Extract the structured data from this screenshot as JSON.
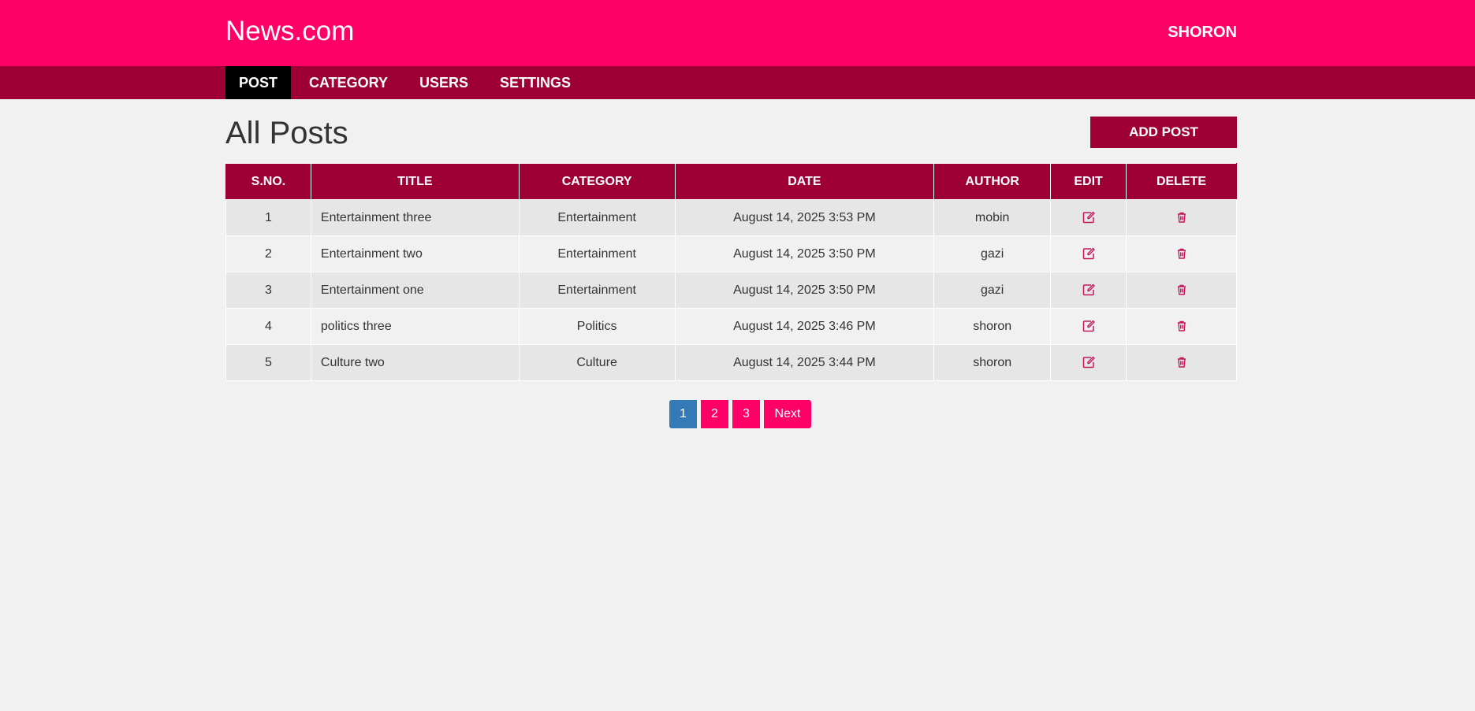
{
  "header": {
    "logo": "News.com",
    "username": "shoron"
  },
  "menu": {
    "items": [
      {
        "label": "POST",
        "active": true
      },
      {
        "label": "CATEGORY"
      },
      {
        "label": "USERS"
      },
      {
        "label": "SETTINGS"
      }
    ]
  },
  "page": {
    "title": "All Posts",
    "add_button": "ADD POST"
  },
  "table": {
    "columns": [
      "S.NO.",
      "TITLE",
      "CATEGORY",
      "DATE",
      "AUTHOR",
      "EDIT",
      "DELETE"
    ],
    "rows": [
      {
        "sno": "1",
        "title": "Entertainment three",
        "category": "Entertainment",
        "date": "August 14, 2025 3:53 PM",
        "author": "mobin"
      },
      {
        "sno": "2",
        "title": "Entertainment two",
        "category": "Entertainment",
        "date": "August 14, 2025 3:50 PM",
        "author": "gazi"
      },
      {
        "sno": "3",
        "title": "Entertainment one",
        "category": "Entertainment",
        "date": "August 14, 2025 3:50 PM",
        "author": "gazi"
      },
      {
        "sno": "4",
        "title": "politics three",
        "category": "Politics",
        "date": "August 14, 2025 3:46 PM",
        "author": "shoron"
      },
      {
        "sno": "5",
        "title": "Culture two",
        "category": "Culture",
        "date": "August 14, 2025 3:44 PM",
        "author": "shoron"
      }
    ],
    "edit_icon": "edit-icon",
    "delete_icon": "trash-icon"
  },
  "pagination": {
    "pages": [
      "1",
      "2",
      "3"
    ],
    "current": "1",
    "next_label": "Next"
  },
  "colors": {
    "brand": "#ff0066",
    "brand_dark": "#9e0036",
    "active_page": "#337ab7"
  }
}
